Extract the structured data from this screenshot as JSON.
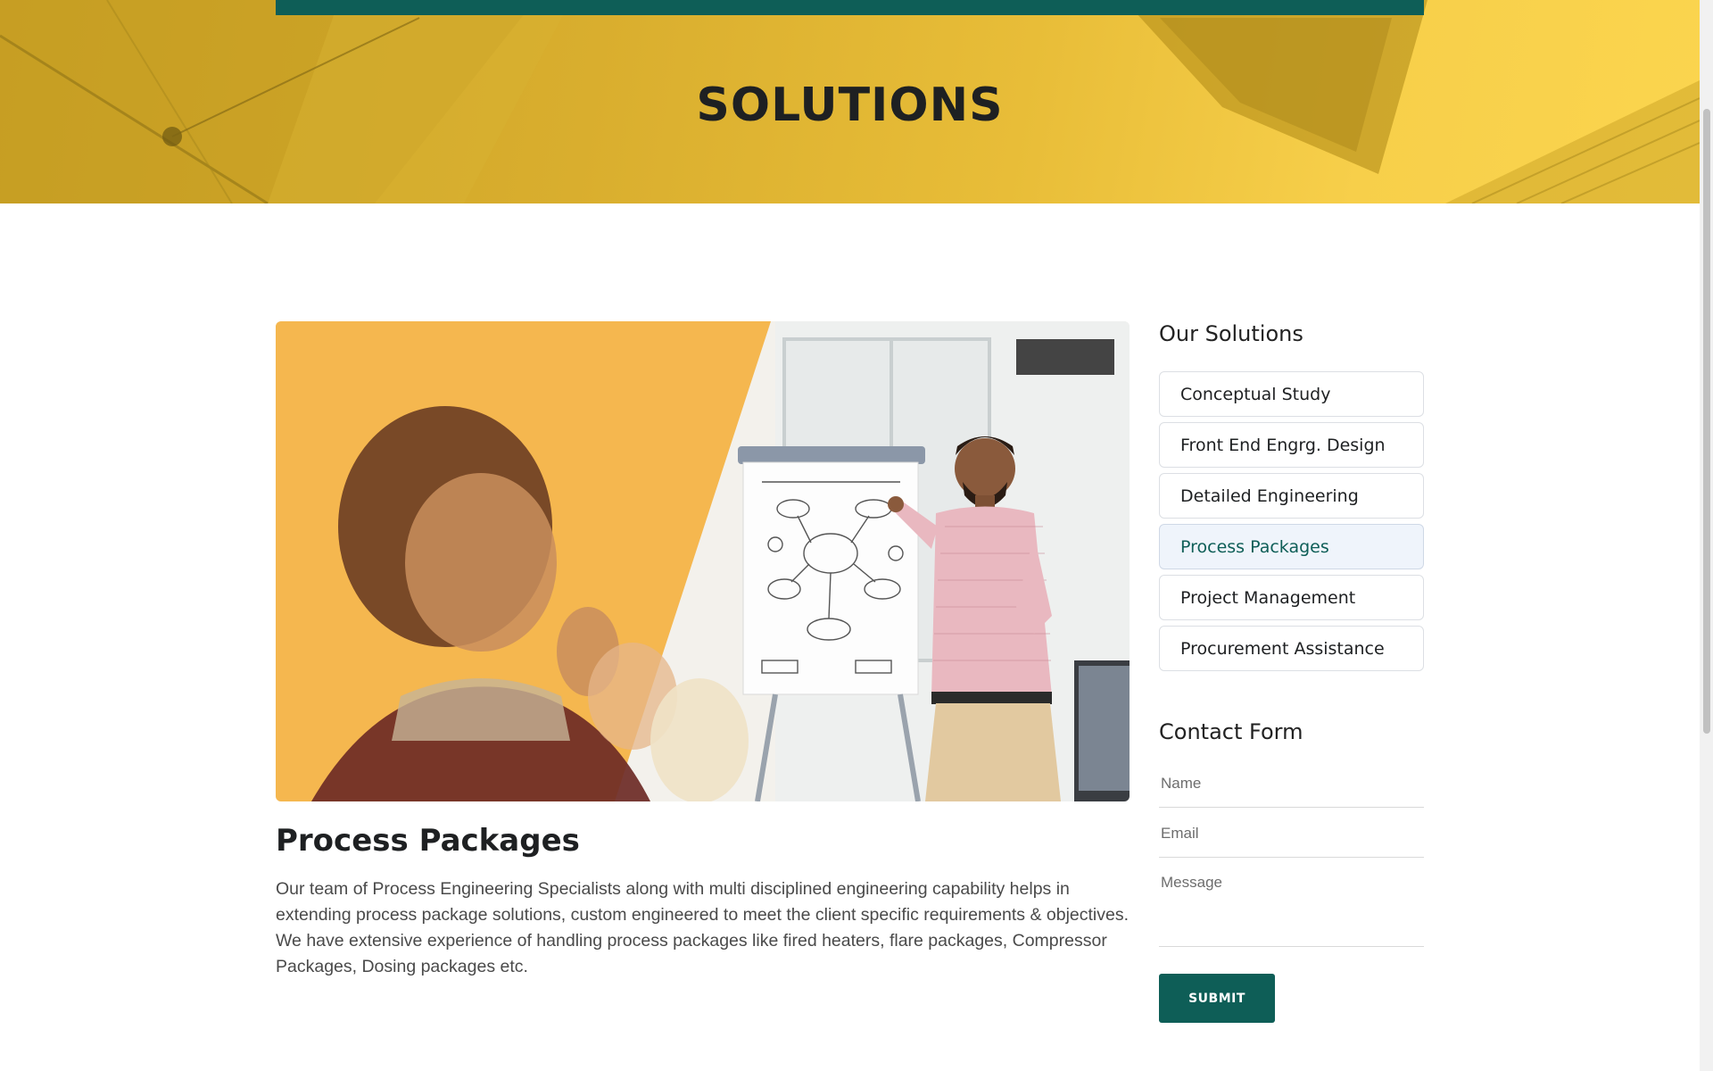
{
  "hero": {
    "title": "SOLUTIONS",
    "accent_color": "#0e5e57",
    "banner_color": "#e8bd38"
  },
  "article": {
    "image_alt": "Presenter at a flip chart explaining a mind map to colleagues",
    "title": "Process Packages",
    "body": "Our team of Process Engineering Specialists along with multi disciplined engineering capability helps in extending process package solutions, custom engineered to meet the client specific requirements & objectives. We have extensive experience of handling process packages like fired heaters, flare packages, Compressor Packages, Dosing packages etc."
  },
  "sidebar": {
    "solutions_heading": "Our Solutions",
    "solutions": [
      {
        "label": "Conceptual Study",
        "active": false
      },
      {
        "label": "Front End Engrg. Design",
        "active": false
      },
      {
        "label": "Detailed Engineering",
        "active": false
      },
      {
        "label": "Process Packages",
        "active": true
      },
      {
        "label": "Project Management",
        "active": false
      },
      {
        "label": "Procurement Assistance",
        "active": false
      }
    ],
    "contact_heading": "Contact Form",
    "form": {
      "name_placeholder": "Name",
      "email_placeholder": "Email",
      "message_placeholder": "Message",
      "submit_label": "SUBMIT"
    }
  },
  "colors": {
    "active_item_bg": "#eff4fb",
    "active_item_text": "#0e5e57",
    "button_bg": "#0e5e57"
  }
}
